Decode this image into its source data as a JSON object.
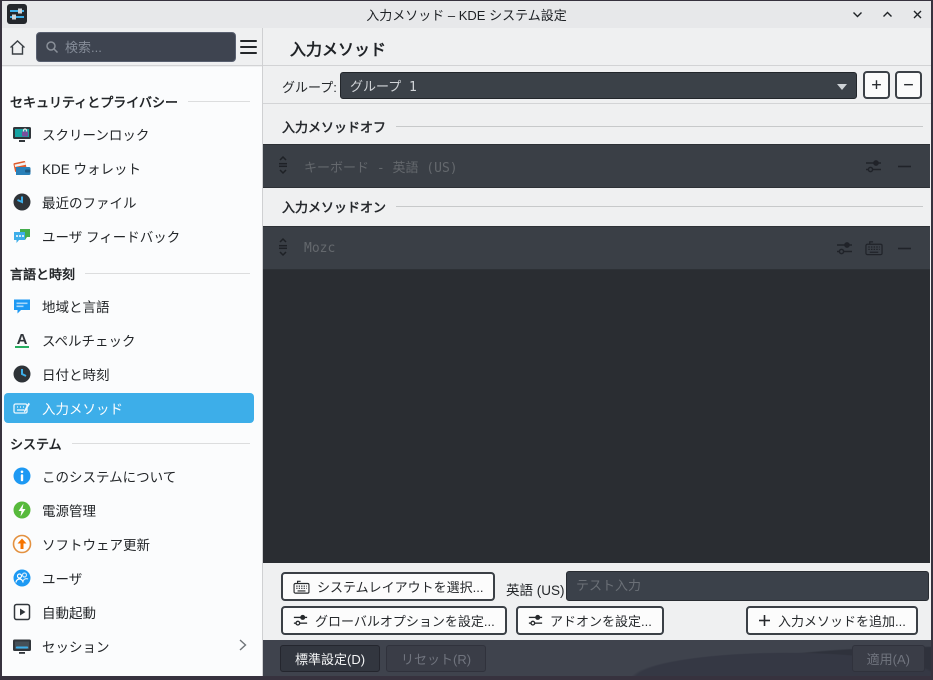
{
  "window": {
    "title": "入力メソッド – KDE システム設定"
  },
  "toolbar": {
    "search_placeholder": "検索...",
    "page_title": "入力メソッド"
  },
  "sidebar": {
    "sections": [
      {
        "label": "セキュリティとプライバシー",
        "items": [
          {
            "label": "スクリーンロック",
            "icon": "screen-lock-icon"
          },
          {
            "label": "KDE ウォレット",
            "icon": "wallet-icon"
          },
          {
            "label": "最近のファイル",
            "icon": "recent-files-icon"
          },
          {
            "label": "ユーザ フィードバック",
            "icon": "feedback-icon"
          }
        ]
      },
      {
        "label": "言語と時刻",
        "items": [
          {
            "label": "地域と言語",
            "icon": "region-language-icon"
          },
          {
            "label": "スペルチェック",
            "icon": "spellcheck-icon"
          },
          {
            "label": "日付と時刻",
            "icon": "date-time-icon"
          },
          {
            "label": "入力メソッド",
            "icon": "input-method-icon",
            "selected": true
          }
        ]
      },
      {
        "label": "システム",
        "items": [
          {
            "label": "このシステムについて",
            "icon": "about-system-icon"
          },
          {
            "label": "電源管理",
            "icon": "power-management-icon"
          },
          {
            "label": "ソフトウェア更新",
            "icon": "software-update-icon"
          },
          {
            "label": "ユーザ",
            "icon": "users-icon"
          },
          {
            "label": "自動起動",
            "icon": "autostart-icon"
          },
          {
            "label": "セッション",
            "icon": "session-icon",
            "has_chevron": true
          }
        ]
      }
    ]
  },
  "main": {
    "group": {
      "label": "グループ:",
      "value": "グループ 1",
      "add": "+",
      "remove": "−"
    },
    "sections": [
      {
        "title": "入力メソッドオフ",
        "rows": [
          {
            "label": "キーボード - 英語 (US)",
            "actions": [
              "configure",
              "remove"
            ]
          }
        ]
      },
      {
        "title": "入力メソッドオン",
        "rows": [
          {
            "label": "Mozc",
            "actions": [
              "configure",
              "keyboard-layout",
              "remove"
            ]
          }
        ]
      }
    ],
    "bottom": {
      "select_system_layout": "システムレイアウトを選択...",
      "current_layout": "英語 (US)",
      "test_input_placeholder": "テスト入力",
      "configure_global_options": "グローバルオプションを設定...",
      "configure_addons": "アドオンを設定...",
      "add_input_method": "入力メソッドを追加..."
    }
  },
  "footer": {
    "defaults": "標準設定(D)",
    "reset": "リセット(R)",
    "apply": "適用(A)"
  },
  "colors": {
    "accent": "#3daee9",
    "titlebar_bg": "#e7e8ea",
    "light_bg": "#eff0f1",
    "sidebar_bg": "#fbfcfd",
    "dark_widget": "#3a3f46",
    "dark_viewport": "#2a2d32",
    "footer_bg": "#3f434d",
    "window_border": "#37323e"
  }
}
